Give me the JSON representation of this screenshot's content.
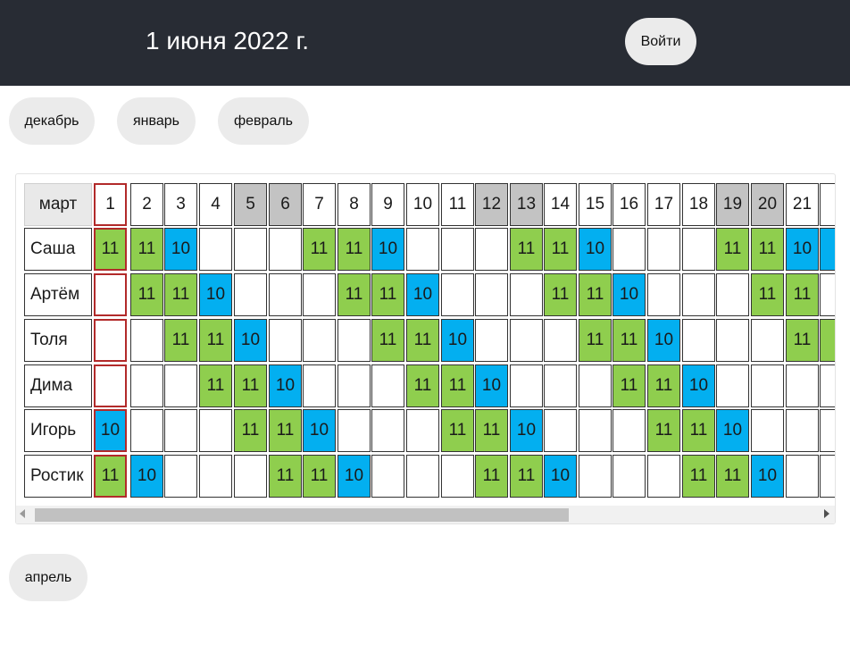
{
  "header": {
    "title": "1 июня 2022 г.",
    "login_label": "Войти"
  },
  "nav": {
    "prev_months": [
      "декабрь",
      "январь",
      "февраль"
    ],
    "next_month": "апрель"
  },
  "schedule": {
    "month": "март",
    "days": [
      1,
      2,
      3,
      4,
      5,
      6,
      7,
      8,
      9,
      10,
      11,
      12,
      13,
      14,
      15,
      16,
      17,
      18,
      19,
      20,
      21
    ],
    "weekend_days": [
      5,
      6,
      12,
      13,
      19,
      20
    ],
    "today_day": 1,
    "rows": [
      {
        "name": "Саша",
        "values": [
          "11",
          "11",
          "10",
          "",
          "",
          "",
          "11",
          "11",
          "10",
          "",
          "",
          "",
          "11",
          "11",
          "10",
          "",
          "",
          "",
          "11",
          "11",
          "10"
        ]
      },
      {
        "name": "Артём",
        "values": [
          "",
          "11",
          "11",
          "10",
          "",
          "",
          "",
          "11",
          "11",
          "10",
          "",
          "",
          "",
          "11",
          "11",
          "10",
          "",
          "",
          "",
          "11",
          "11"
        ]
      },
      {
        "name": "Толя",
        "values": [
          "",
          "",
          "11",
          "11",
          "10",
          "",
          "",
          "",
          "11",
          "11",
          "10",
          "",
          "",
          "",
          "11",
          "11",
          "10",
          "",
          "",
          "",
          "11"
        ]
      },
      {
        "name": "Дима",
        "values": [
          "",
          "",
          "",
          "11",
          "11",
          "10",
          "",
          "",
          "",
          "11",
          "11",
          "10",
          "",
          "",
          "",
          "11",
          "11",
          "10",
          "",
          "",
          ""
        ]
      },
      {
        "name": "Игорь",
        "values": [
          "10",
          "",
          "",
          "",
          "11",
          "11",
          "10",
          "",
          "",
          "",
          "11",
          "11",
          "10",
          "",
          "",
          "",
          "11",
          "11",
          "10",
          "",
          ""
        ]
      },
      {
        "name": "Ростик",
        "values": [
          "11",
          "10",
          "",
          "",
          "",
          "11",
          "11",
          "10",
          "",
          "",
          "",
          "11",
          "11",
          "10",
          "",
          "",
          "",
          "11",
          "11",
          "10",
          ""
        ]
      }
    ],
    "partial_column_colors": [
      "v10",
      "v10",
      "",
      "v11",
      "",
      "",
      ""
    ]
  },
  "colors": {
    "header_bg": "#282c34",
    "value_11": "#8fce4e",
    "value_10": "#03aff0",
    "weekend": "#c3c3c3",
    "today_border": "#b22a2a"
  }
}
